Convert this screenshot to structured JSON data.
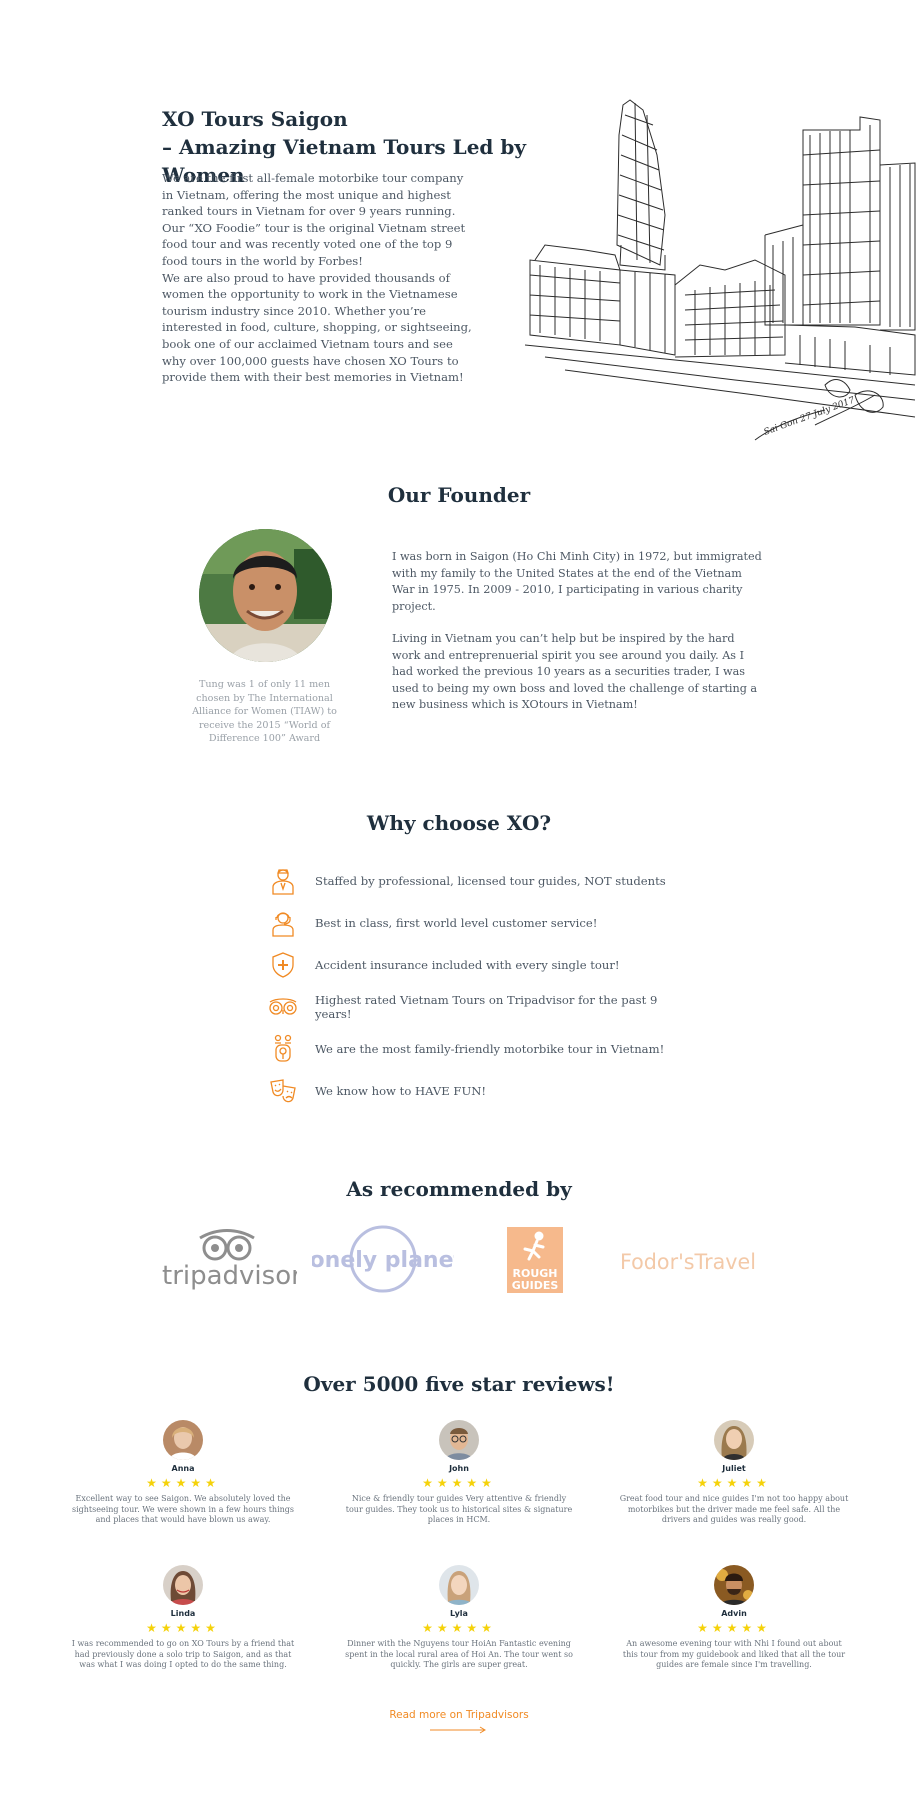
{
  "hero": {
    "title_line1": "XO Tours Saigon",
    "title_line2": "– Amazing Vietnam Tours Led by Women",
    "paragraph1": "We are the first all-female motorbike tour company in Vietnam, offering the most unique and highest ranked tours in Vietnam for over 9 years running. Our “XO Foodie” tour is the original Vietnam street food tour and was recently voted one of the top 9 food tours in the world by Forbes!",
    "paragraph2": "We are also proud to have provided thousands of women the opportunity to work in the Vietnamese tourism industry since 2010. Whether you’re interested in food, culture, shopping, or sightseeing, book one of our acclaimed Vietnam tours and see why over 100,000 guests have chosen XO Tours to provide them with their best memories in Vietnam!"
  },
  "founder": {
    "heading": "Our Founder",
    "caption": "Tung was 1 of only 11 men chosen by The International Alliance for Women (TIAW) to receive the 2015 “World of Difference 100” Award",
    "paragraph1": "I was born in Saigon (Ho Chi Minh City) in 1972, but immigrated with my family to the United States at the end of the Vietnam War in 1975. In 2009 - 2010, I participating in various charity project.",
    "paragraph2": "Living in Vietnam you can’t help but be inspired by the hard work and entreprenuerial spirit you see around you daily. As I had worked the previous 10 years as a securities trader, I was used to being my own boss and loved the challenge of starting a new business which is XOtours in Vietnam!"
  },
  "why": {
    "heading": "Why choose XO?",
    "accent_color": "#f08a24",
    "items": [
      {
        "icon": "tour-guide-icon",
        "text": "Staffed by professional, licensed tour guides, NOT students"
      },
      {
        "icon": "customer-service-icon",
        "text": "Best in class, first world level customer service!"
      },
      {
        "icon": "insurance-shield-icon",
        "text": "Accident insurance included with every single tour!"
      },
      {
        "icon": "tripadvisor-owl-icon",
        "text": "Highest rated Vietnam Tours on Tripadvisor for the past 9 years!"
      },
      {
        "icon": "family-icon",
        "text": "We are the most family-friendly motorbike tour in Vietnam!"
      },
      {
        "icon": "fun-masks-icon",
        "text": "We know how to HAVE FUN!"
      }
    ]
  },
  "recommended": {
    "heading": "As recommended by",
    "logos": [
      {
        "name": "tripadvisor",
        "text": "tripadvisor",
        "color": "#8e8e8e"
      },
      {
        "name": "lonely-planet",
        "text": "lonely planet",
        "color": "#b9bfe0"
      },
      {
        "name": "rough-guides",
        "line1": "ROUGH",
        "line2": "GUIDES",
        "color": "#f6b98c"
      },
      {
        "name": "fodors-travel",
        "text": "Fodor'sTravel",
        "color": "#f3c9a8"
      }
    ]
  },
  "reviews": {
    "heading": "Over 5000 five star reviews!",
    "star_color": "#f5d20a",
    "stars": "★★★★★",
    "items": [
      {
        "name": "Anna",
        "text": "Excellent way to see Saigon. We absolutely loved the sightseeing tour. We were shown in a few hours things and places that would have blown us away."
      },
      {
        "name": "John",
        "text": "Nice & friendly tour guides Very attentive & friendly tour guides. They took us to historical sites & signature places in HCM."
      },
      {
        "name": "Juliet",
        "text": "Great food tour and nice guides I'm not too happy about motorbikes but the driver made me feel safe. All the drivers and guides was really good."
      },
      {
        "name": "Linda",
        "text": "I was recommended to go on XO Tours by a friend that had previously done a solo trip to Saigon, and as that was what I was doing I opted to do the same thing."
      },
      {
        "name": "Lyla",
        "text": "Dinner with the Nguyens tour HoiAn Fantastic evening spent in the local rural area of Hoi An. The tour went so quickly. The girls are super great."
      },
      {
        "name": "Advin",
        "text": "An awesome evening tour with Nhi I found out about this tour from my guidebook and liked that all the tour guides are female since I'm travelling."
      }
    ],
    "read_more": "Read more on Tripadvisors"
  }
}
